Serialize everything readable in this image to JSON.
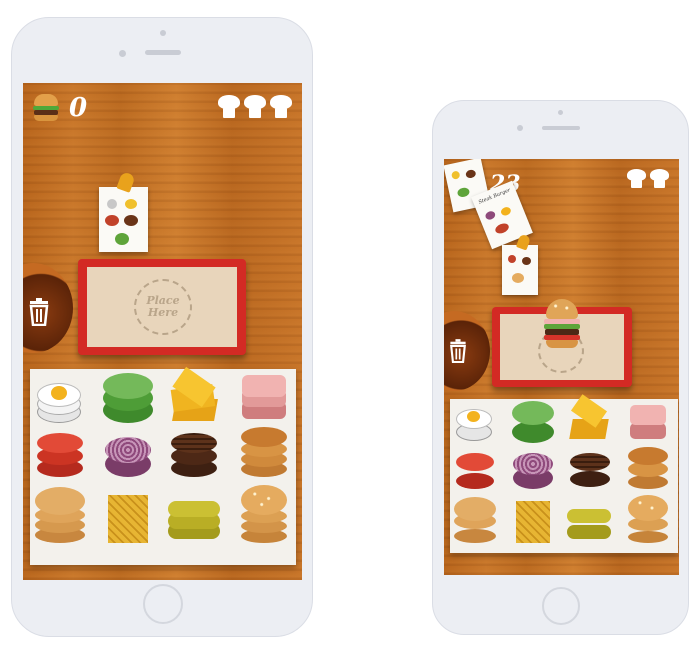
{
  "left_phone": {
    "score": "0",
    "place_label_line1": "Place",
    "place_label_line2": "Here",
    "chef_lives": 3
  },
  "right_phone": {
    "score": "23",
    "chef_lives": 2,
    "order_card_title": "Steak Burger"
  },
  "ingredients": [
    "egg",
    "lettuce",
    "cheese",
    "ham",
    "tomato",
    "onion",
    "patty",
    "bacon-bun",
    "bottom-bun",
    "fries",
    "pickles",
    "top-bun"
  ],
  "colors": {
    "tray": "#d32a24",
    "wood": "#c0702a",
    "paper": "#e8d5bb"
  }
}
